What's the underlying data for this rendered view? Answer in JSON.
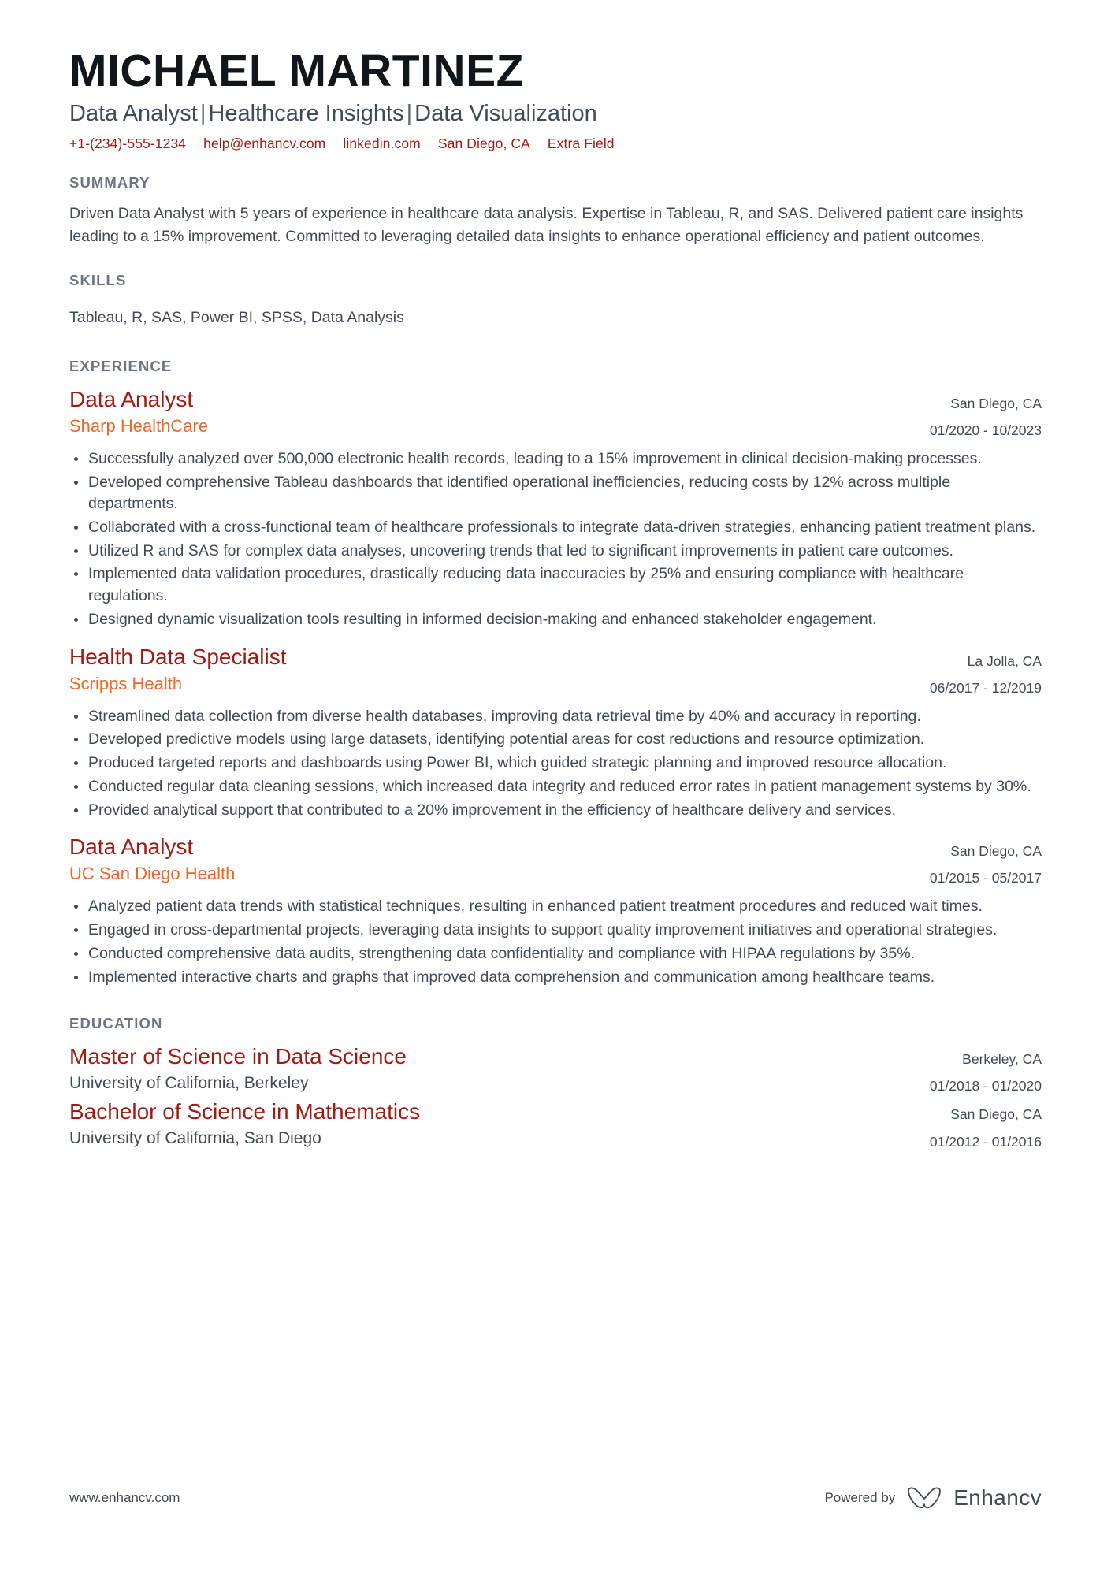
{
  "header": {
    "name": "MICHAEL MARTINEZ",
    "headline_parts": [
      "Data Analyst",
      "Healthcare Insights",
      "Data Visualization"
    ],
    "headline_separator": "|",
    "contacts": [
      "+1-(234)-555-1234",
      "help@enhancv.com",
      "linkedin.com",
      "San Diego, CA",
      "Extra Field"
    ]
  },
  "colors": {
    "accent_red": "#a11b15",
    "title_red": "#9e1a12",
    "company_orange": "#f26522",
    "body_text": "#404a55",
    "section_heading": "#6b7480",
    "name_black": "#11161b"
  },
  "summary": {
    "title": "SUMMARY",
    "text": "Driven Data Analyst with 5 years of experience in healthcare data analysis. Expertise in Tableau, R, and SAS. Delivered patient care insights leading to a 15% improvement. Committed to leveraging detailed data insights to enhance operational efficiency and patient outcomes."
  },
  "skills": {
    "title": "SKILLS",
    "text": "Tableau, R, SAS, Power BI, SPSS, Data Analysis"
  },
  "experience": {
    "title": "EXPERIENCE",
    "entries": [
      {
        "title": "Data Analyst",
        "company": "Sharp HealthCare",
        "location": "San Diego, CA",
        "dates": "01/2020 - 10/2023",
        "bullets": [
          "Successfully analyzed over 500,000 electronic health records, leading to a 15% improvement in clinical decision-making processes.",
          "Developed comprehensive Tableau dashboards that identified operational inefficiencies, reducing costs by 12% across multiple departments.",
          "Collaborated with a cross-functional team of healthcare professionals to integrate data-driven strategies, enhancing patient treatment plans.",
          "Utilized R and SAS for complex data analyses, uncovering trends that led to significant improvements in patient care outcomes.",
          "Implemented data validation procedures, drastically reducing data inaccuracies by 25% and ensuring compliance with healthcare regulations.",
          "Designed dynamic visualization tools resulting in informed decision-making and enhanced stakeholder engagement."
        ]
      },
      {
        "title": "Health Data Specialist",
        "company": "Scripps Health",
        "location": "La Jolla, CA",
        "dates": "06/2017 - 12/2019",
        "bullets": [
          "Streamlined data collection from diverse health databases, improving data retrieval time by 40% and accuracy in reporting.",
          "Developed predictive models using large datasets, identifying potential areas for cost reductions and resource optimization.",
          "Produced targeted reports and dashboards using Power BI, which guided strategic planning and improved resource allocation.",
          "Conducted regular data cleaning sessions, which increased data integrity and reduced error rates in patient management systems by 30%.",
          "Provided analytical support that contributed to a 20% improvement in the efficiency of healthcare delivery and services."
        ]
      },
      {
        "title": "Data Analyst",
        "company": "UC San Diego Health",
        "location": "San Diego, CA",
        "dates": "01/2015 - 05/2017",
        "bullets": [
          "Analyzed patient data trends with statistical techniques, resulting in enhanced patient treatment procedures and reduced wait times.",
          "Engaged in cross-departmental projects, leveraging data insights to support quality improvement initiatives and operational strategies.",
          "Conducted comprehensive data audits, strengthening data confidentiality and compliance with HIPAA regulations by 35%.",
          "Implemented interactive charts and graphs that improved data comprehension and communication among healthcare teams."
        ]
      }
    ]
  },
  "education": {
    "title": "EDUCATION",
    "entries": [
      {
        "degree": "Master of Science in Data Science",
        "school": "University of California, Berkeley",
        "location": "Berkeley, CA",
        "dates": "01/2018 - 01/2020"
      },
      {
        "degree": "Bachelor of Science in Mathematics",
        "school": "University of California, San Diego",
        "location": "San Diego, CA",
        "dates": "01/2012 - 01/2016"
      }
    ]
  },
  "footer": {
    "url": "www.enhancv.com",
    "powered_by": "Powered by",
    "brand": "Enhancv"
  }
}
